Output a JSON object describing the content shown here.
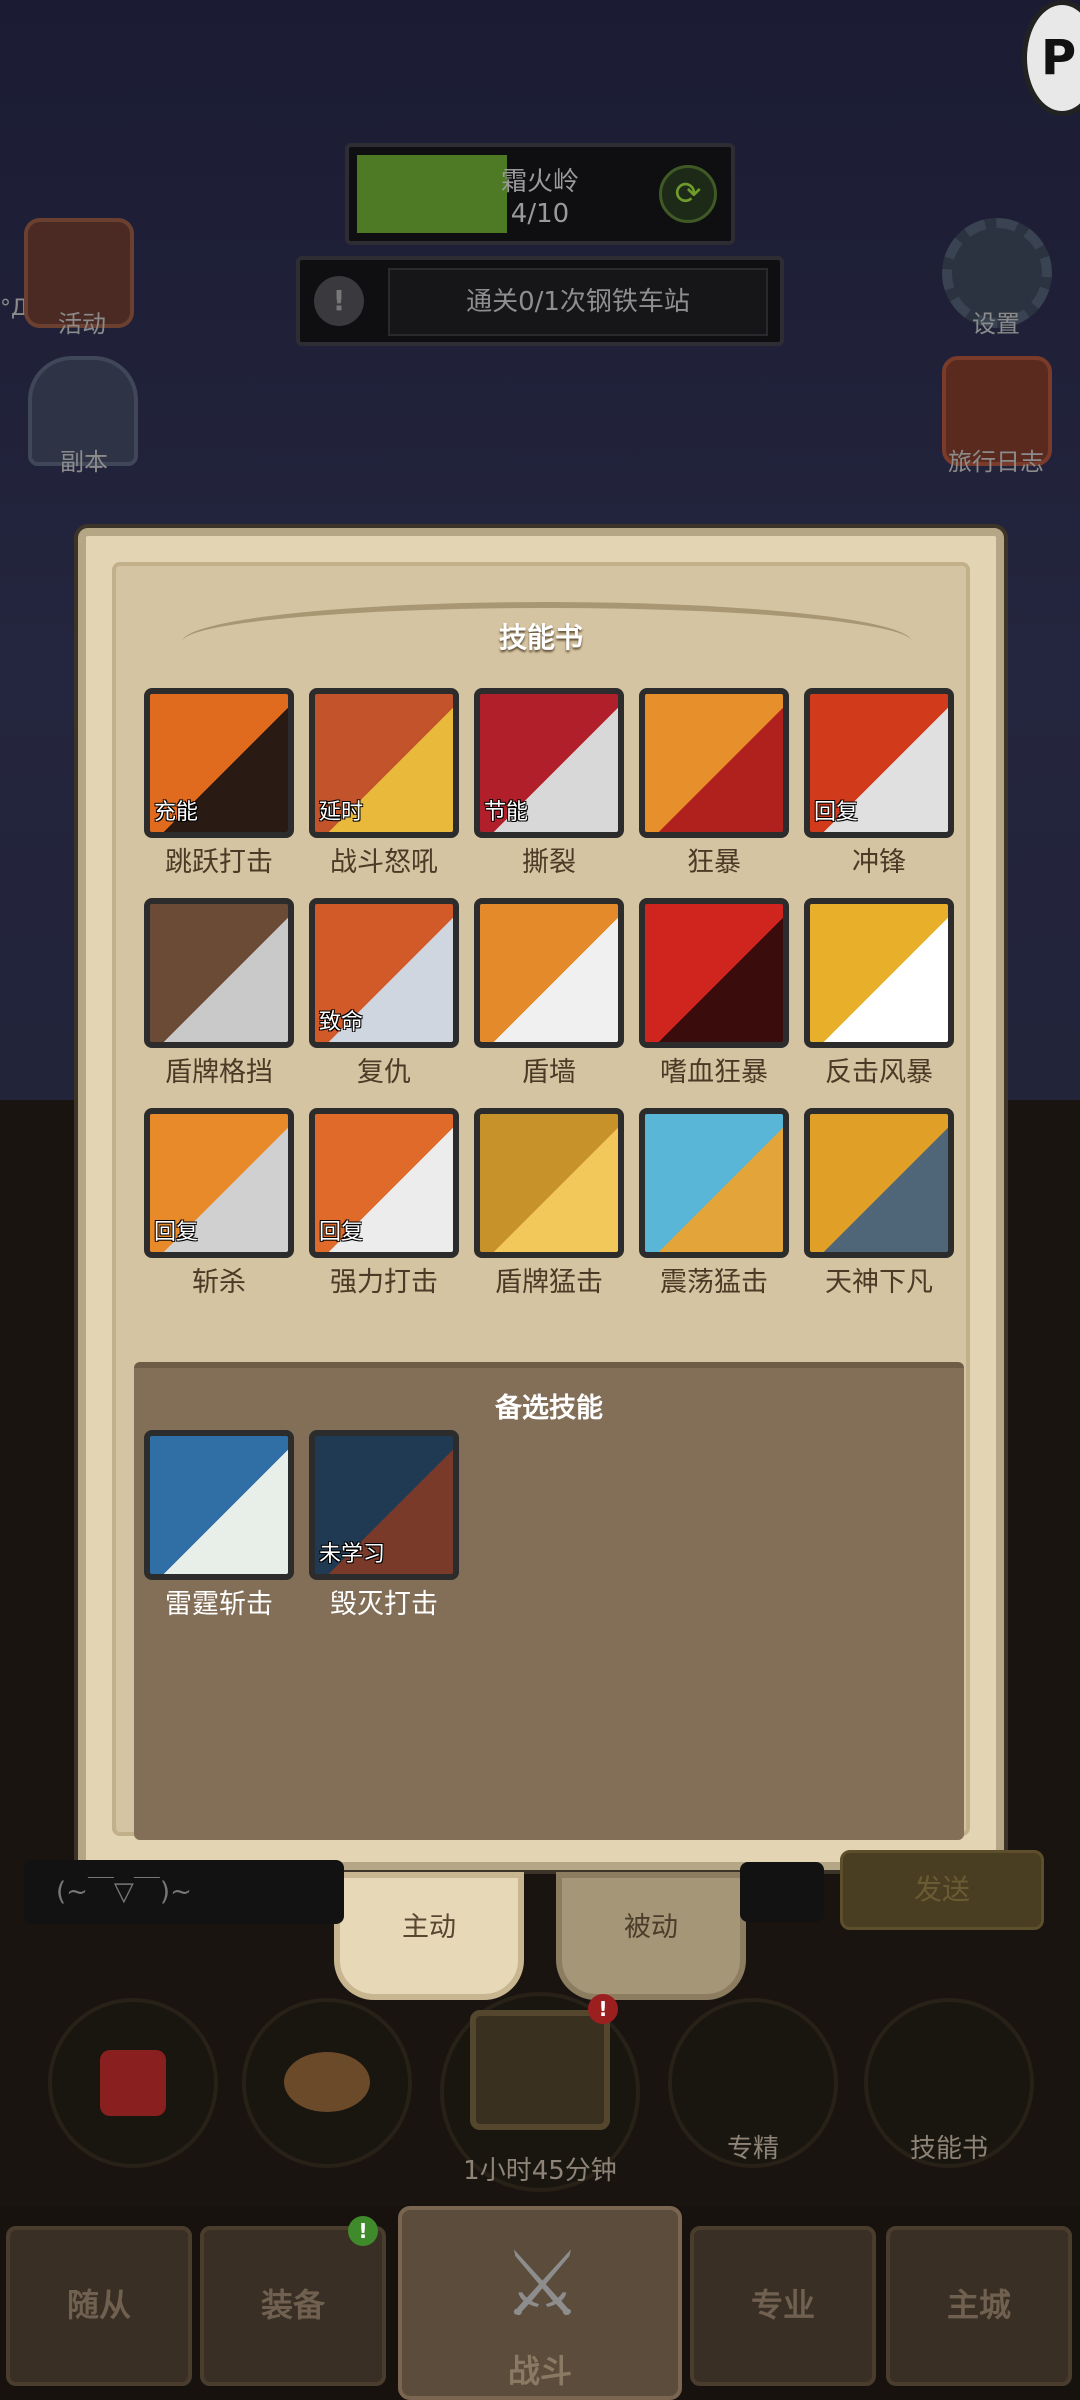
{
  "stage": {
    "name": "霜火岭",
    "progress_text": "4/10",
    "progress": 0.4
  },
  "quest": {
    "text": "通关0/1次钢铁车站"
  },
  "left_icons": [
    {
      "label": "活动"
    },
    {
      "label": "副本"
    }
  ],
  "right_icons": [
    {
      "label": "设置"
    },
    {
      "label": "旅行日志"
    }
  ],
  "left_overlay_text": "°Д°;",
  "dialog": {
    "title": "技能书",
    "skills": [
      {
        "name": "跳跃打击",
        "tag": "充能",
        "icon": "leap-strike-icon"
      },
      {
        "name": "战斗怒吼",
        "tag": "延时",
        "icon": "battle-shout-icon"
      },
      {
        "name": "撕裂",
        "tag": "节能",
        "icon": "rend-icon"
      },
      {
        "name": "狂暴",
        "tag": "",
        "icon": "berserk-icon"
      },
      {
        "name": "冲锋",
        "tag": "回复",
        "icon": "charge-icon"
      },
      {
        "name": "盾牌格挡",
        "tag": "",
        "icon": "shield-block-icon"
      },
      {
        "name": "复仇",
        "tag": "致命",
        "icon": "revenge-icon"
      },
      {
        "name": "盾墙",
        "tag": "",
        "icon": "shield-wall-icon"
      },
      {
        "name": "嗜血狂暴",
        "tag": "",
        "icon": "bloodthirst-icon"
      },
      {
        "name": "反击风暴",
        "tag": "",
        "icon": "retaliation-icon"
      },
      {
        "name": "斩杀",
        "tag": "回复",
        "icon": "execute-icon"
      },
      {
        "name": "强力打击",
        "tag": "回复",
        "icon": "power-strike-icon"
      },
      {
        "name": "盾牌猛击",
        "tag": "",
        "icon": "shield-slam-icon"
      },
      {
        "name": "震荡猛击",
        "tag": "",
        "icon": "concussion-blow-icon"
      },
      {
        "name": "天神下凡",
        "tag": "",
        "icon": "avatar-icon"
      }
    ],
    "spare_title": "备选技能",
    "spare_skills": [
      {
        "name": "雷霆斩击",
        "tag": "",
        "icon": "thunder-slash-icon"
      },
      {
        "name": "毁灭打击",
        "tag": "未学习",
        "icon": "devastate-icon"
      }
    ]
  },
  "tabs": {
    "active": "主动",
    "passive": "被动"
  },
  "chat": {
    "emote": "(~￣▽￣)~",
    "send_label": "发送"
  },
  "hud": [
    {
      "label": "",
      "icon": "potion-icon"
    },
    {
      "label": "",
      "icon": "bread-icon"
    },
    {
      "label": "1小时45分钟",
      "icon": "treasure-chest-icon"
    },
    {
      "label": "专精",
      "icon": "specialization-icon"
    },
    {
      "label": "技能书",
      "icon": "skill-book-icon"
    }
  ],
  "nav": [
    {
      "label": "随从"
    },
    {
      "label": "装备"
    },
    {
      "label": "战斗"
    },
    {
      "label": "专业"
    },
    {
      "label": "主城"
    }
  ],
  "colors": {
    "progress_fill": "#4e7a26",
    "parchment": "#d5c4a1",
    "spare_panel": "#836f58"
  }
}
